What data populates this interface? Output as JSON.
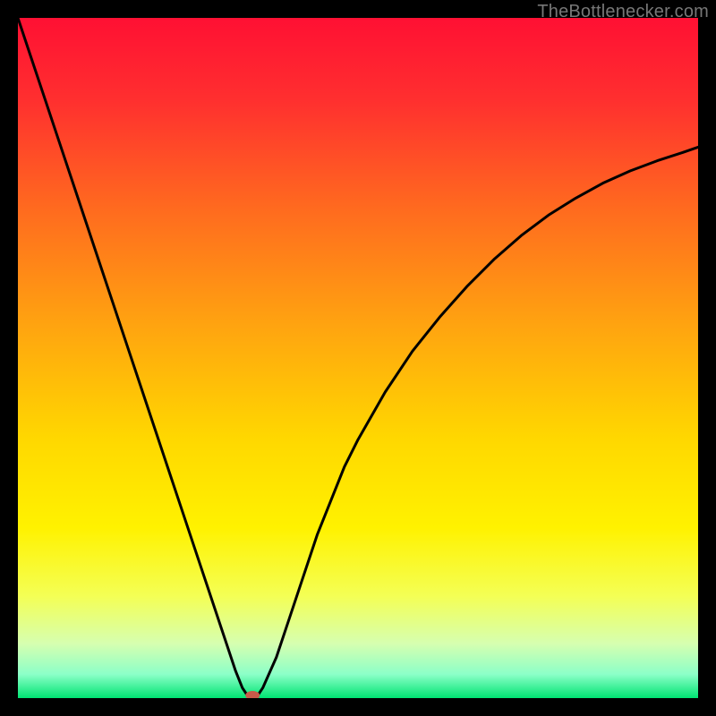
{
  "watermark": {
    "text": "TheBottlenecker.com"
  },
  "chart_data": {
    "type": "line",
    "title": "",
    "xlabel": "",
    "ylabel": "",
    "xlim": [
      0,
      100
    ],
    "ylim": [
      0,
      100
    ],
    "background_gradient": {
      "stops": [
        {
          "offset": 0.0,
          "color": "#ff1033"
        },
        {
          "offset": 0.12,
          "color": "#ff2f2f"
        },
        {
          "offset": 0.28,
          "color": "#ff6a1f"
        },
        {
          "offset": 0.45,
          "color": "#ffa310"
        },
        {
          "offset": 0.62,
          "color": "#ffd800"
        },
        {
          "offset": 0.75,
          "color": "#fff200"
        },
        {
          "offset": 0.85,
          "color": "#f4ff55"
        },
        {
          "offset": 0.92,
          "color": "#d6ffb0"
        },
        {
          "offset": 0.965,
          "color": "#8cffc8"
        },
        {
          "offset": 1.0,
          "color": "#00e472"
        }
      ]
    },
    "curve_color": "#000000",
    "curve_width": 3,
    "curve": {
      "x": [
        0,
        2,
        4,
        6,
        8,
        10,
        12,
        14,
        16,
        18,
        20,
        22,
        24,
        26,
        28,
        30,
        32,
        33,
        34,
        35,
        36,
        38,
        40,
        42,
        44,
        46,
        48,
        50,
        54,
        58,
        62,
        66,
        70,
        74,
        78,
        82,
        86,
        90,
        94,
        98,
        100
      ],
      "y": [
        100,
        94,
        88,
        82,
        76,
        70,
        64,
        58,
        52,
        46,
        40,
        34,
        28,
        22,
        16,
        10,
        4,
        1.5,
        0,
        0,
        1.5,
        6,
        12,
        18,
        24,
        29,
        34,
        38,
        45,
        51,
        56,
        60.5,
        64.5,
        68,
        71,
        73.5,
        75.7,
        77.5,
        79,
        80.3,
        81
      ]
    },
    "marker": {
      "x": 34.5,
      "y": 0,
      "rx": 8,
      "ry": 5,
      "fill": "#c85a4a"
    }
  }
}
